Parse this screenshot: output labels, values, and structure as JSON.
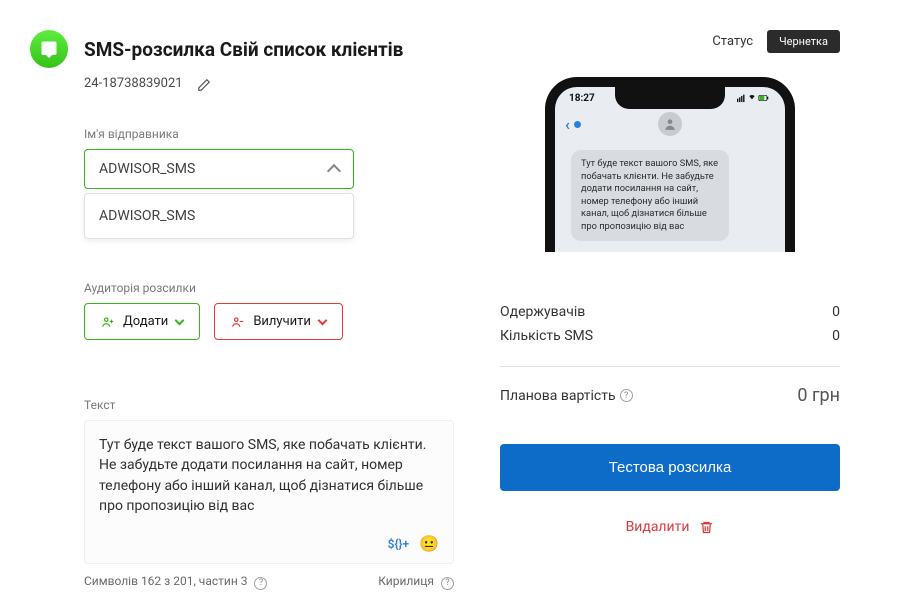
{
  "header": {
    "title": "SMS-розсилка Свій список клієнтів",
    "id": "24-18738839021"
  },
  "sender": {
    "label": "Ім'я відправника",
    "selected": "ADWISOR_SMS",
    "options": [
      "ADWISOR_SMS"
    ]
  },
  "audience": {
    "label": "Аудиторія розсилки",
    "add_label": "Додати",
    "remove_label": "Вилучити"
  },
  "text": {
    "label": "Текст",
    "content": "Тут буде текст вашого SMS, яке побачать клієнти. Не забудьте додати посилання на сайт, номер телефону або інший канал, щоб дізнатися більше про пропозицію від вас",
    "var_chip": "${}+",
    "counter": "Символів 162 з 201, частин 3",
    "encoding": "Кирилиця"
  },
  "status": {
    "label": "Статус",
    "badge": "Чернетка"
  },
  "phone": {
    "time": "18:27",
    "bubble": "Тут буде текст вашого SMS, яке побачать клієнти. Не забудьте додати посилання на сайт, номер телефону або інший канал, щоб дізнатися більше про пропозицію від вас"
  },
  "stats": {
    "recipients_label": "Одержувачів",
    "recipients_value": "0",
    "sms_count_label": "Кількість SMS",
    "sms_count_value": "0",
    "cost_label": "Планова вартість",
    "cost_value": "0 грн"
  },
  "actions": {
    "test_send": "Тестова розсилка",
    "delete": "Видалити"
  }
}
